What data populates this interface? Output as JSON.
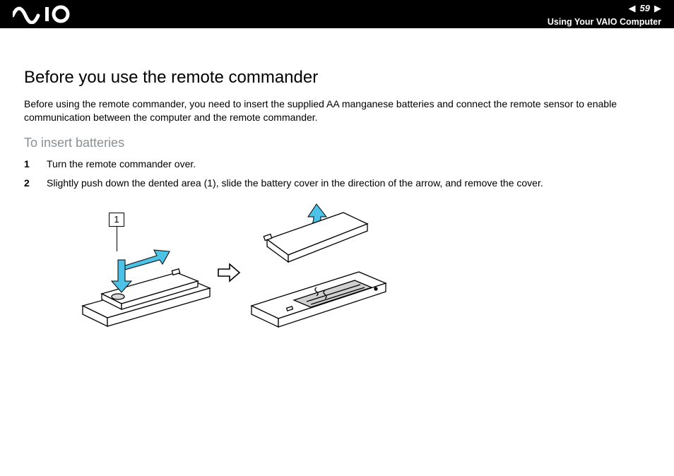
{
  "header": {
    "brand": "VAIO",
    "page_number": "59",
    "section": "Using Your VAIO Computer"
  },
  "content": {
    "heading": "Before you use the remote commander",
    "intro": "Before using the remote commander, you need to insert the supplied AA manganese batteries and connect the remote sensor to enable communication between the computer and the remote commander.",
    "subheading": "To insert batteries",
    "steps": [
      {
        "n": "1",
        "text": "Turn the remote commander over."
      },
      {
        "n": "2",
        "text": "Slightly push down the dented area (1), slide the battery cover in the direction of the arrow, and remove the cover."
      }
    ],
    "figure": {
      "callout_label": "1"
    }
  }
}
